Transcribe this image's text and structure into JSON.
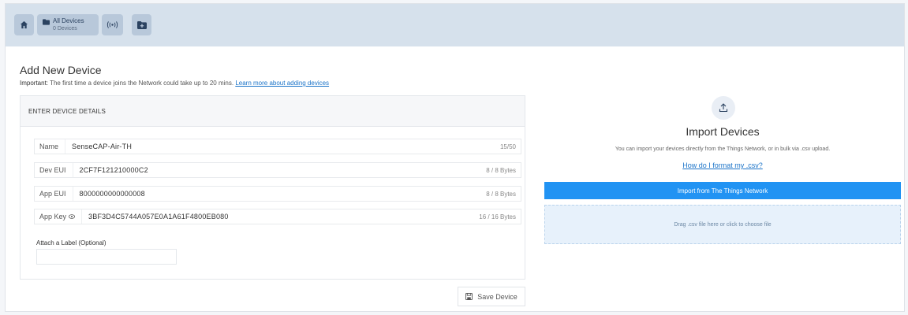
{
  "nav": {
    "all_devices_label": "All Devices",
    "all_devices_count": "0 Devices"
  },
  "page": {
    "title": "Add New Device",
    "notice_strong": "Important:",
    "notice_text": " The first time a device joins the Network could take up to 20 mins. ",
    "notice_link": "Learn more about adding devices"
  },
  "form": {
    "header": "ENTER DEVICE DETAILS",
    "fields": [
      {
        "label": "Name",
        "value": "SenseCAP-Air-TH",
        "count": "15/50"
      },
      {
        "label": "Dev EUI",
        "value": "2CF7F121210000C2",
        "count": "8 / 8 Bytes"
      },
      {
        "label": "App EUI",
        "value": "8000000000000008",
        "count": "8 / 8 Bytes"
      },
      {
        "label": "App Key",
        "value": "3BF3D4C5744A057E0A1A61F4800EB080",
        "count": "16 / 16 Bytes"
      }
    ],
    "attach_label": "Attach a Label (Optional)",
    "attach_value": "",
    "save_label": "Save Device"
  },
  "import": {
    "title": "Import Devices",
    "description": "You can import your devices directly from the Things Network, or in bulk via .csv upload.",
    "help_link": "How do I format my .csv?",
    "ttn_button": "Import from The Things Network",
    "dropzone_text": "Drag .csv file here or click to choose file"
  },
  "colors": {
    "topbar": "#d6e1ec",
    "nav_button": "#b8c8da",
    "primary": "#2193f3",
    "link": "#1a73c8",
    "dropzone": "#e7f1fb"
  }
}
